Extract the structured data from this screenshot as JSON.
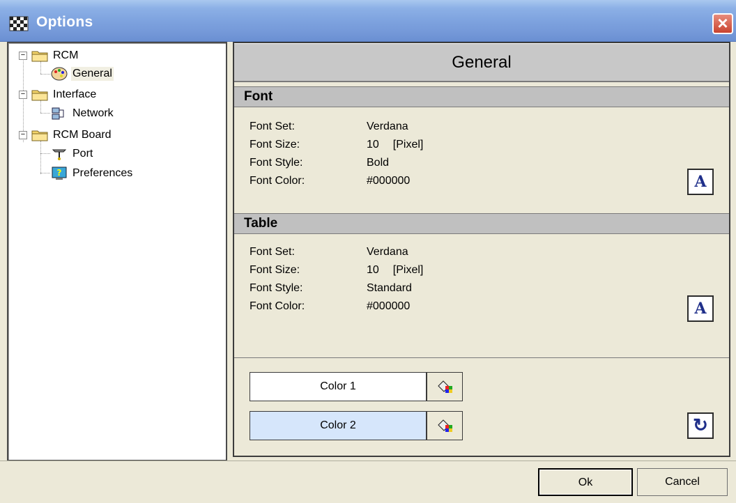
{
  "window": {
    "title": "Options"
  },
  "tree": {
    "items": [
      {
        "label": "RCM",
        "icon": "folder-icon",
        "level": 0,
        "expander": "−"
      },
      {
        "label": "General",
        "icon": "palette-icon",
        "level": 1,
        "selected": true
      },
      {
        "label": "Interface",
        "icon": "folder-icon",
        "level": 0,
        "expander": "−"
      },
      {
        "label": "Network",
        "icon": "network-icon",
        "level": 1
      },
      {
        "label": "RCM Board",
        "icon": "folder-icon",
        "level": 0,
        "expander": "−"
      },
      {
        "label": "Port",
        "icon": "port-icon",
        "level": 1
      },
      {
        "label": "Preferences",
        "icon": "help-icon",
        "level": 1
      }
    ]
  },
  "panel": {
    "header": "General",
    "font_section": {
      "title": "Font",
      "rows": [
        {
          "key": "Font Set:",
          "value": "Verdana",
          "unit": ""
        },
        {
          "key": "Font Size:",
          "value": "10",
          "unit": "[Pixel]"
        },
        {
          "key": "Font Style:",
          "value": "Bold",
          "unit": ""
        },
        {
          "key": "Font Color:",
          "value": "#000000",
          "unit": ""
        }
      ],
      "button_glyph": "A"
    },
    "table_section": {
      "title": "Table",
      "rows": [
        {
          "key": "Font Set:",
          "value": "Verdana",
          "unit": ""
        },
        {
          "key": "Font Size:",
          "value": "10",
          "unit": "[Pixel]"
        },
        {
          "key": "Font Style:",
          "value": "Standard",
          "unit": ""
        },
        {
          "key": "Font Color:",
          "value": "#000000",
          "unit": ""
        }
      ],
      "button_glyph": "A"
    },
    "colors": [
      {
        "label": "Color 1",
        "color": "#ffffff"
      },
      {
        "label": "Color 2",
        "color": "#d6e6fb"
      }
    ],
    "reset_glyph": "↻"
  },
  "footer": {
    "ok_label": "Ok",
    "cancel_label": "Cancel"
  }
}
